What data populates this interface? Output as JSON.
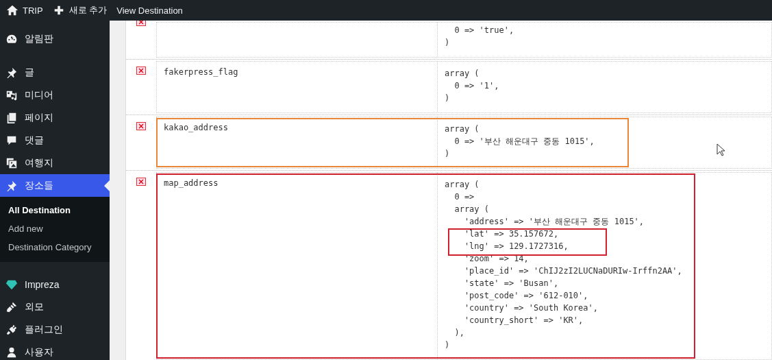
{
  "top_bar": {
    "site": "TRIP",
    "new_label": "새로 추가",
    "view_label": "View Destination"
  },
  "sidebar": {
    "groups": [
      {
        "items": [
          {
            "kind": "gauge",
            "label": "알림판",
            "selected": false
          }
        ]
      },
      {
        "items": [
          {
            "kind": "pin",
            "label": "글",
            "selected": false
          },
          {
            "kind": "media",
            "label": "미디어",
            "selected": false
          },
          {
            "kind": "pages",
            "label": "페이지",
            "selected": false
          },
          {
            "kind": "comment",
            "label": "댓글",
            "selected": false
          },
          {
            "kind": "photos",
            "label": "여행지",
            "selected": false
          },
          {
            "kind": "pin",
            "label": "장소들",
            "selected": true,
            "children": [
              {
                "label": "All Destination",
                "selected": true
              },
              {
                "label": "Add new",
                "selected": false
              },
              {
                "label": "Destination Category",
                "selected": false
              }
            ]
          }
        ]
      },
      {
        "items": [
          {
            "kind": "gem",
            "label": "Impreza",
            "selected": false
          },
          {
            "kind": "brush",
            "label": "외모",
            "selected": false
          },
          {
            "kind": "plug",
            "label": "플러그인",
            "selected": false
          },
          {
            "kind": "user",
            "label": "사용자",
            "selected": false
          }
        ]
      }
    ]
  },
  "table": {
    "rows": [
      {
        "lines": [
          {
            "text": "  0 => 'true',",
            "boxed": false
          },
          {
            "text": ")",
            "boxed": false
          }
        ]
      },
      {
        "key": "fakerpress_flag",
        "lines": [
          {
            "text": "array (",
            "boxed": false
          },
          {
            "text": "  0 => '1',",
            "boxed": false
          },
          {
            "text": ")",
            "boxed": false
          }
        ]
      },
      {
        "key": "kakao_address",
        "highlight": {
          "color": "#e8873a",
          "kind": "short"
        },
        "lines": [
          {
            "text": "array (",
            "boxed": false
          },
          {
            "text": "  0 => '부산 해운대구 중동 1015',",
            "boxed": false
          },
          {
            "text": ")",
            "boxed": false
          }
        ]
      },
      {
        "key": "map_address",
        "highlight": {
          "color": "#d0202e",
          "kind": "long"
        },
        "lines": [
          {
            "text": "array (",
            "boxed": false
          },
          {
            "text": "  0 =>",
            "boxed": false
          },
          {
            "text": "  array (",
            "boxed": false
          },
          {
            "text": "    'address' => '부산 해운대구 중동 1015',",
            "boxed": false
          },
          {
            "text": "    'lat' => 35.157672,",
            "boxed": true
          },
          {
            "text": "    'lng' => 129.1727316,",
            "boxed": true
          },
          {
            "text": "    'zoom' => 14,",
            "boxed": false
          },
          {
            "text": "    'place_id' => 'ChIJ2zI2LUCNaDURIw-Irffn2AA',",
            "boxed": false
          },
          {
            "text": "    'state' => 'Busan',",
            "boxed": false
          },
          {
            "text": "    'post_code' => '612-010',",
            "boxed": false
          },
          {
            "text": "    'country' => 'South Korea',",
            "boxed": false
          },
          {
            "text": "    'country_short' => 'KR',",
            "boxed": false
          },
          {
            "text": "  ),",
            "boxed": false
          },
          {
            "text": ")",
            "boxed": false
          }
        ]
      }
    ]
  }
}
